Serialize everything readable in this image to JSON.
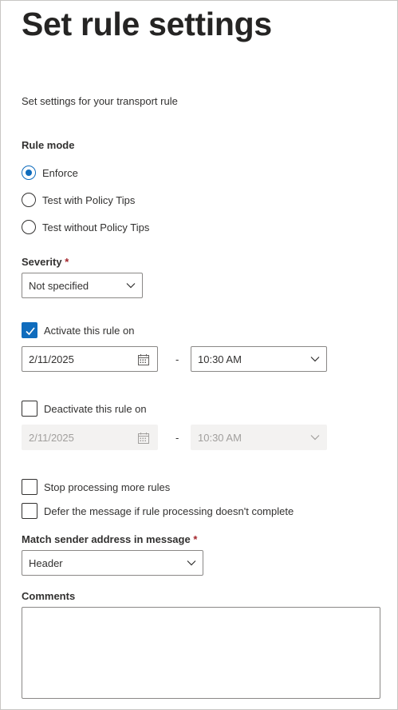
{
  "page": {
    "title": "Set rule settings",
    "subtitle": "Set settings for your transport rule"
  },
  "rule_mode": {
    "label": "Rule mode",
    "options": [
      {
        "label": "Enforce",
        "selected": true
      },
      {
        "label": "Test with Policy Tips",
        "selected": false
      },
      {
        "label": "Test without Policy Tips",
        "selected": false
      }
    ]
  },
  "severity": {
    "label": "Severity",
    "required_mark": "*",
    "value": "Not specified"
  },
  "activate": {
    "label": "Activate this rule on",
    "checked": true,
    "date": "2/11/2025",
    "separator": "-",
    "time": "10:30 AM"
  },
  "deactivate": {
    "label": "Deactivate this rule on",
    "checked": false,
    "date": "2/11/2025",
    "separator": "-",
    "time": "10:30 AM",
    "disabled": true
  },
  "options": {
    "stop_processing": {
      "label": "Stop processing more rules",
      "checked": false
    },
    "defer_message": {
      "label": "Defer the message if rule processing doesn't complete",
      "checked": false
    }
  },
  "match_sender": {
    "label": "Match sender address in message",
    "required_mark": "*",
    "value": "Header"
  },
  "comments": {
    "label": "Comments",
    "value": ""
  },
  "colors": {
    "accent": "#0f6cbd",
    "required": "#a4262c",
    "disabled_bg": "#f3f2f1"
  },
  "icons": {
    "calendar": "calendar-icon",
    "chevron": "chevron-down-icon",
    "checkmark": "checkmark-icon"
  }
}
